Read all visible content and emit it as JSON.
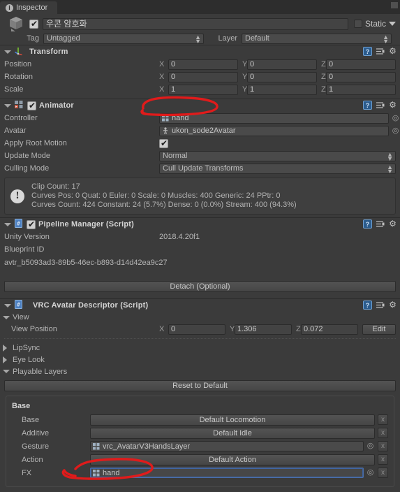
{
  "window": {
    "tab_label": "Inspector",
    "tab_icon": "inspector-icon"
  },
  "object_header": {
    "enabled": true,
    "name": "우콘 암호화",
    "static_label": "Static",
    "static_checked": false,
    "tag_label": "Tag",
    "tag_value": "Untagged",
    "layer_label": "Layer",
    "layer_value": "Default"
  },
  "components": [
    {
      "id": "transform",
      "title": "Transform",
      "icon": "transform-axis-icon",
      "has_checkbox": false,
      "rows": [
        {
          "label": "Position",
          "x": "0",
          "y": "0",
          "z": "0"
        },
        {
          "label": "Rotation",
          "x": "0",
          "y": "0",
          "z": "0"
        },
        {
          "label": "Scale",
          "x": "1",
          "y": "1",
          "z": "1"
        }
      ]
    },
    {
      "id": "animator",
      "title": "Animator",
      "icon": "animator-icon",
      "enabled": true,
      "controller_label": "Controller",
      "controller_value": "hand",
      "avatar_label": "Avatar",
      "avatar_value": "ukon_sode2Avatar",
      "apply_root_motion_label": "Apply Root Motion",
      "apply_root_motion_checked": true,
      "update_mode_label": "Update Mode",
      "update_mode_value": "Normal",
      "culling_mode_label": "Culling Mode",
      "culling_mode_value": "Cull Update Transforms",
      "info": [
        "Clip Count: 17",
        "Curves Pos: 0 Quat: 0 Euler: 0 Scale: 0 Muscles: 400 Generic: 24 PPtr: 0",
        "Curves Count: 424 Constant: 24 (5.7%) Dense: 0 (0.0%) Stream: 400 (94.3%)"
      ]
    },
    {
      "id": "pipeline-manager",
      "title": "Pipeline Manager (Script)",
      "icon": "script-icon",
      "enabled": true,
      "unity_version_label": "Unity Version",
      "unity_version_value": "2018.4.20f1",
      "blueprint_id_label": "Blueprint ID",
      "blueprint_id_value": "avtr_b5093ad3-89b5-46ec-b893-d14d42ea9c27",
      "detach_button": "Detach (Optional)"
    },
    {
      "id": "vrc-avatar-descriptor",
      "title": "VRC Avatar Descriptor (Script)",
      "icon": "script-icon",
      "view_section_label": "View",
      "view_position_label": "View Position",
      "view_position": {
        "x": "0",
        "y": "1.306",
        "z": "0.072"
      },
      "edit_button": "Edit",
      "lipsync_label": "LipSync",
      "eyelook_label": "Eye Look",
      "playable_layers_label": "Playable Layers",
      "reset_button": "Reset to Default",
      "base_group_label": "Base",
      "layers": [
        {
          "name": "Base",
          "value": "Default Locomotion",
          "kind": "button",
          "clear": "x"
        },
        {
          "name": "Additive",
          "value": "Default Idle",
          "kind": "button",
          "clear": "x"
        },
        {
          "name": "Gesture",
          "value": "vrc_AvatarV3HandsLayer",
          "kind": "object",
          "clear": "x"
        },
        {
          "name": "Action",
          "value": "Default Action",
          "kind": "button",
          "clear": "x"
        },
        {
          "name": "FX",
          "value": "hand",
          "kind": "object",
          "clear": "x",
          "selected": true
        }
      ]
    }
  ],
  "annotations": {
    "color": "#e01b1b",
    "marks": [
      "circle-around-animator-controller",
      "circle-around-fx-layer"
    ]
  }
}
